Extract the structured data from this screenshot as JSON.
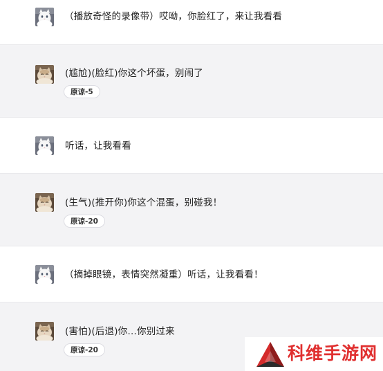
{
  "messages": [
    {
      "role": "user",
      "text": "（播放奇怪的录像带）哎呦，你脸红了，来让我看看"
    },
    {
      "role": "bot",
      "text": "(尴尬)(脸红)你这个坏蛋，别闹了",
      "badge": "原谅-5"
    },
    {
      "role": "user",
      "text": "听话，让我看看"
    },
    {
      "role": "bot",
      "text": "(生气)(推开你)你这个混蛋，别碰我！",
      "badge": "原谅-20"
    },
    {
      "role": "user",
      "text": "（摘掉眼镜，表情突然凝重）听话，让我看看！"
    },
    {
      "role": "bot",
      "text": "(害怕)(后退)你…你别过来",
      "badge": "原谅-20"
    }
  ],
  "watermark": {
    "text": "科维手游网"
  },
  "icons": {
    "user_avatar": "white-cat-avatar-icon",
    "bot_avatar": "tan-cat-avatar-icon",
    "watermark_logo": "red-triangle-logo-icon"
  },
  "colors": {
    "user_row_bg": "#ffffff",
    "bot_row_bg": "#f3f3f5",
    "watermark_red": "#e02f2f",
    "text": "#222222"
  }
}
